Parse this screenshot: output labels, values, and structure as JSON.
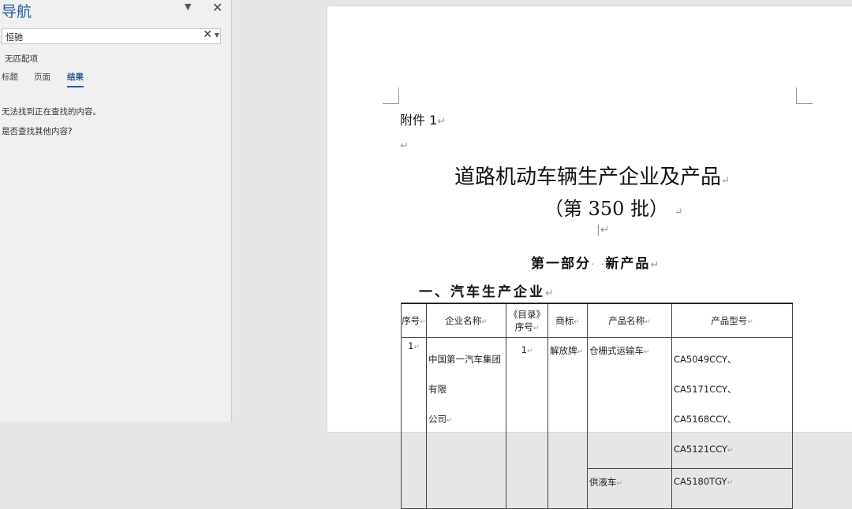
{
  "nav": {
    "title": "导航",
    "dropdown_icon": "chevron-down-icon",
    "close_glyph": "✕",
    "search_value": "恒驰",
    "clear_glyph": "✕",
    "search_dropdown": "⌄",
    "no_match": "无匹配项",
    "tabs": [
      "标题",
      "页面",
      "结果"
    ],
    "active_tab": "结果",
    "message1": "无法找到正在查找的内容。",
    "message2": "是否查找其他内容?"
  },
  "doc": {
    "paragraph_mark": "↵",
    "attachment": "附件 1",
    "title_line1": "道路机动车辆生产企业及产品",
    "title_line2": "（第 350 批）",
    "part": "第一部分",
    "part_dots": "· ·",
    "part_name": "新产品",
    "section": "一、汽车生产企业",
    "table": {
      "headers": [
        "序号",
        "企业名称",
        "《目录》序号",
        "商标",
        "产品名称",
        "产品型号"
      ],
      "row1": {
        "no": "1",
        "company_line1": "中国第一汽车集团有限",
        "company_line2": "公司",
        "catalog_no": "1",
        "brand": "解放牌",
        "product_a": "仓栅式运输车",
        "models_a1": "CA5049CCY、CA5171CCY、",
        "models_a2": "CA5168CCY、CA5121CCY",
        "product_b": "供液车",
        "models_b": "CA5180TGY"
      }
    }
  }
}
